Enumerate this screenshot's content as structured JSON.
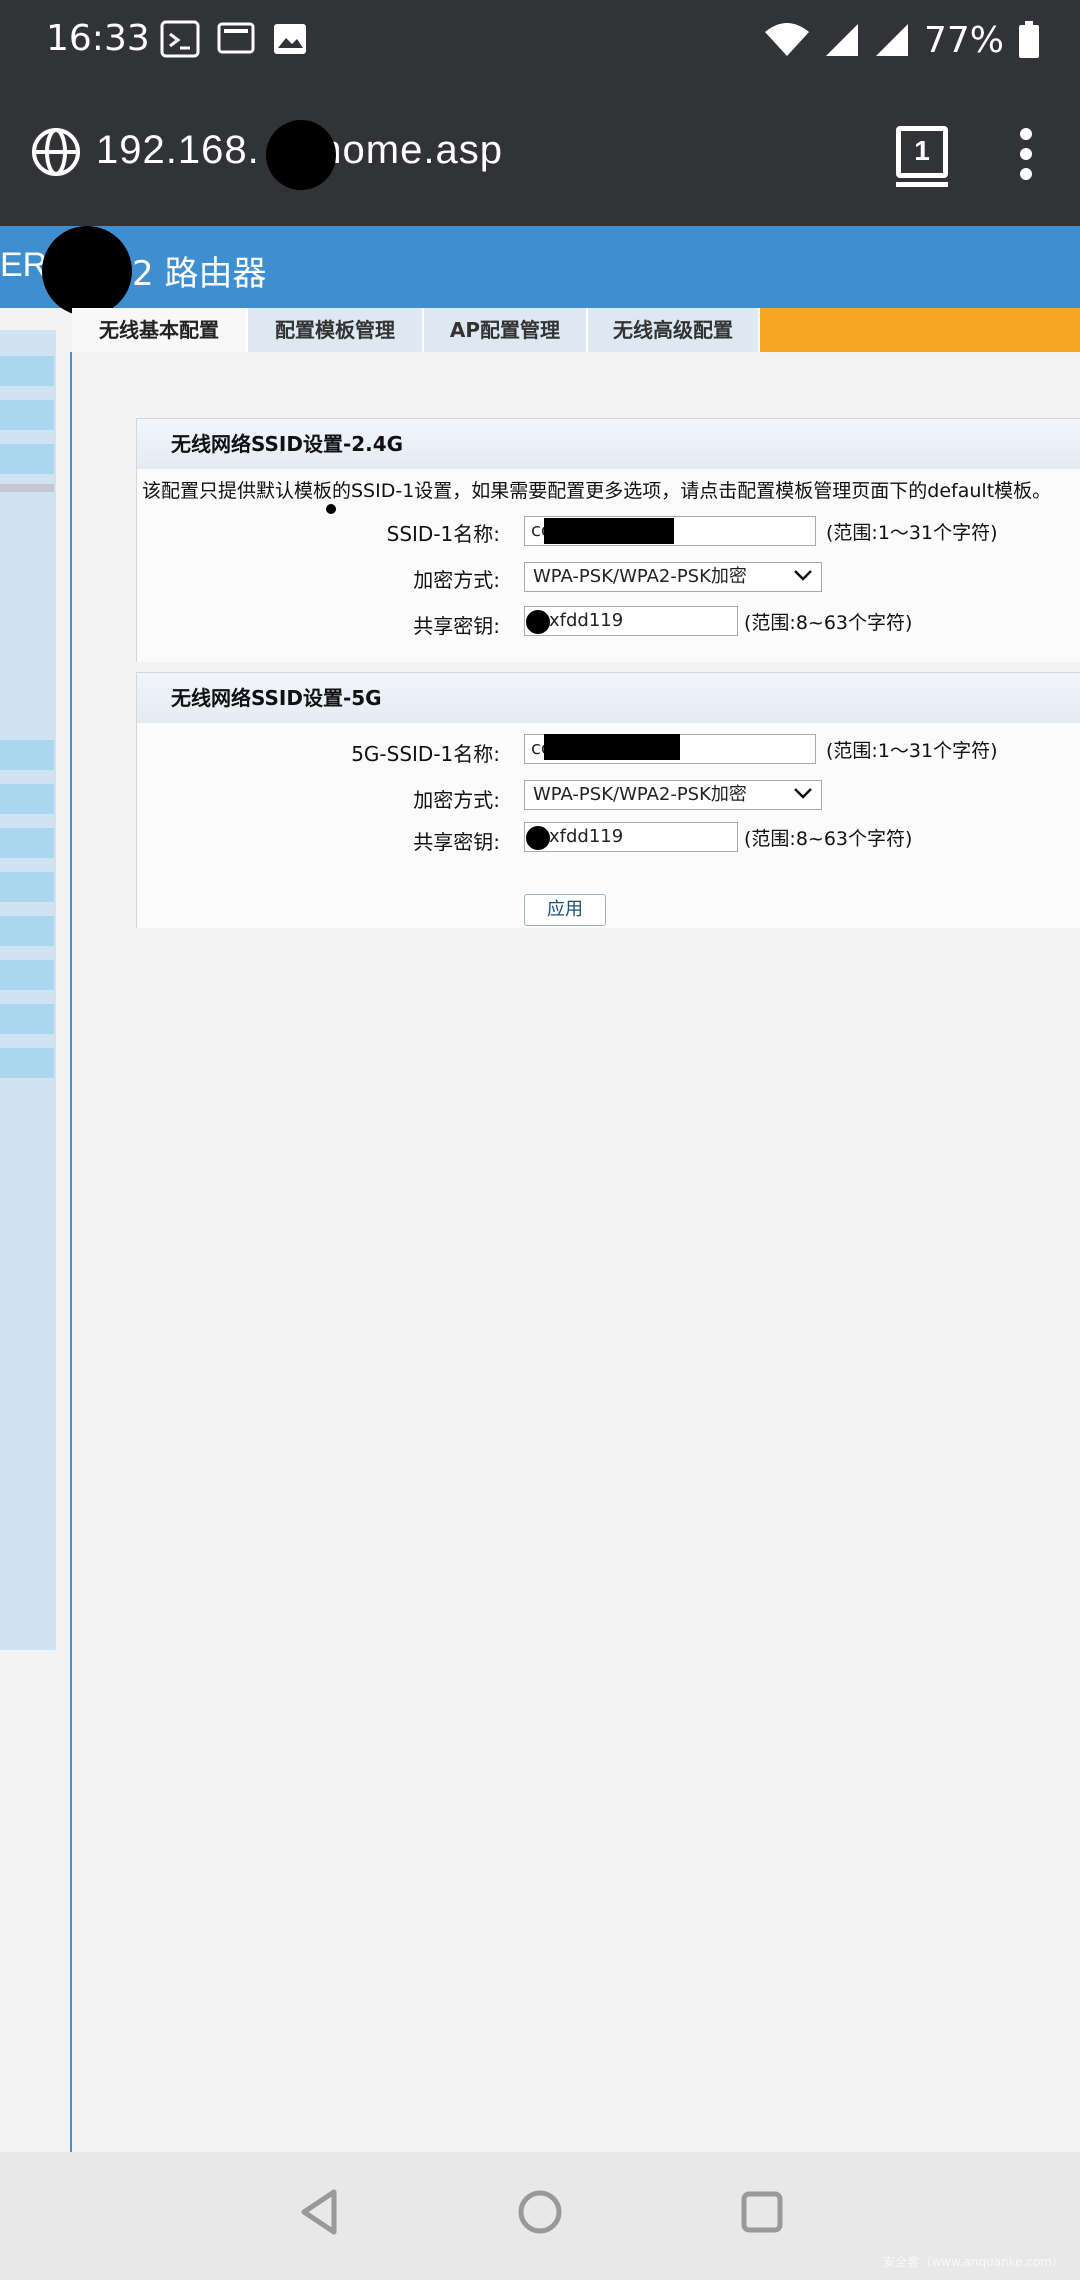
{
  "status_bar": {
    "time": "16:33",
    "battery": "77%",
    "icons": [
      "terminal-app-icon",
      "screen-icon",
      "image-icon",
      "wifi-icon",
      "signal-icon",
      "signal-icon-2",
      "battery-icon"
    ]
  },
  "browser": {
    "url": "192.168.      .1/home.asp",
    "tab_count": "1"
  },
  "router": {
    "title_prefix": "ER",
    "title_suffix": "2 路由器",
    "tabs": [
      {
        "label": "无线基本配置",
        "active": true
      },
      {
        "label": "配置模板管理",
        "active": false
      },
      {
        "label": "AP配置管理",
        "active": false
      },
      {
        "label": "无线高级配置",
        "active": false
      }
    ]
  },
  "wifi24": {
    "heading": "无线网络SSID设置-2.4G",
    "note": "该配置只提供默认模板的SSID-1设置，如果需要配置更多选项，请点击配置模板管理页面下的default模板。",
    "ssid_label": "SSID-1名称:",
    "ssid_value": "cc",
    "ssid_hint": "(范围:1～31个字符)",
    "encryption_label": "加密方式:",
    "encryption_value": "WPA-PSK/WPA2-PSK加密",
    "key_label": "共享密钥:",
    "key_value": "xfdd119",
    "key_hint": "(范围:8~63个字符)"
  },
  "wifi5": {
    "heading": "无线网络SSID设置-5G",
    "ssid_label": "5G-SSID-1名称:",
    "ssid_value": "cc",
    "ssid_hint": "(范围:1～31个字符)",
    "encryption_label": "加密方式:",
    "encryption_value": "WPA-PSK/WPA2-PSK加密",
    "key_label": "共享密钥:",
    "key_value": "xfdd119",
    "key_hint": "(范围:8~63个字符)",
    "apply_label": "应用"
  },
  "watermark": "安全客（www.anquanke.com）",
  "colors": {
    "status_bar": "#323337",
    "header_blue": "#3f8fd0",
    "tab_orange": "#f5a623",
    "sidebar": "#d0e3f3"
  }
}
